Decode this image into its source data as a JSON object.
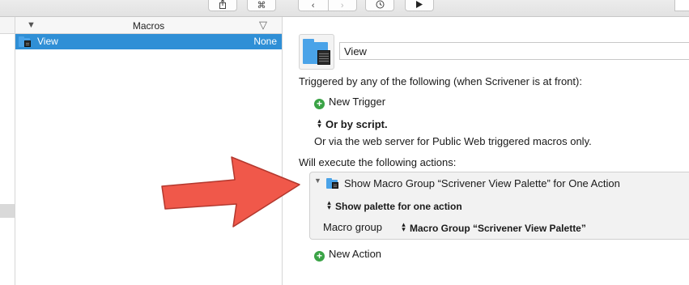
{
  "toolbar": {
    "share_icon": "share-icon",
    "command_icon": "⌘",
    "back_icon": "back-icon",
    "forward_icon": "forward-icon",
    "history_icon": "history-icon",
    "run_icon": "run-icon"
  },
  "macro_list": {
    "header_title": "Macros",
    "rows": [
      {
        "name": "View",
        "trigger": "None",
        "selected": true
      }
    ]
  },
  "editor": {
    "macro_name": "View",
    "triggered_by": "Triggered by any of the following (when Scrivener is at front):",
    "new_trigger_label": "New Trigger",
    "or_by_script": "Or by script.",
    "web_server_text": "Or via the web server for Public Web triggered macros only.",
    "will_execute": "Will execute the following actions:",
    "action": {
      "title": "Show Macro Group “Scrivener View Palette” for One Action",
      "mode_label": "Show palette for one action",
      "macro_group_label": "Macro group",
      "macro_group_value": "Macro Group “Scrivener View Palette”"
    },
    "new_action_label": "New Action"
  },
  "colors": {
    "selection": "#2f8fd6",
    "folder": "#4aa3e8",
    "add_button": "#3aa346",
    "annotation_arrow": "#f0584a"
  }
}
